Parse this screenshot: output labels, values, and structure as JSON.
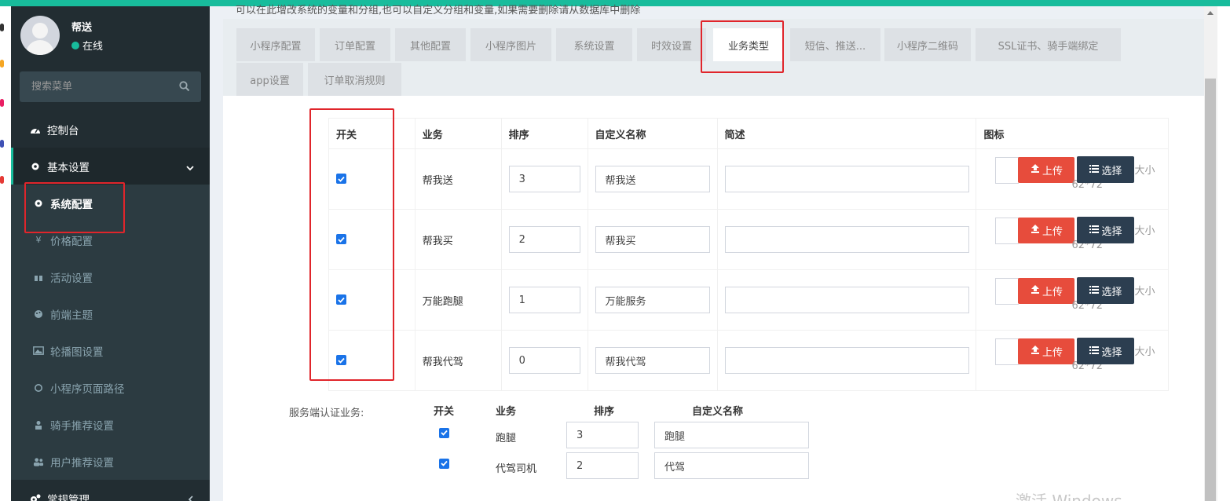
{
  "user": {
    "name": "帮送",
    "status": "在线"
  },
  "search": {
    "placeholder": "搜索菜单"
  },
  "menu": {
    "dashboard": "控制台",
    "basic_settings": "基本设置",
    "sub": [
      "系统配置",
      "价格配置",
      "活动设置",
      "前端主题",
      "轮播图设置",
      "小程序页面路径",
      "骑手推荐设置",
      "用户推荐设置"
    ],
    "general": "常规管理"
  },
  "tip": "可以在此增改系统的变量和分组,也可以自定义分组和变量,如果需要删除请从数据库中删除",
  "tabs": [
    "小程序配置",
    "订单配置",
    "其他配置",
    "小程序图片",
    "系统设置",
    "时效设置",
    "业务类型",
    "短信、推送...",
    "小程序二维码",
    "SSL证书、骑手端绑定",
    "app设置",
    "订单取消规则"
  ],
  "active_tab": "业务类型",
  "business_table": {
    "headers": [
      "开关",
      "业务",
      "排序",
      "自定义名称",
      "简述",
      "图标"
    ],
    "rows": [
      {
        "enabled": true,
        "business": "帮我送",
        "sort": "3",
        "custom_name": "帮我送",
        "desc": ""
      },
      {
        "enabled": true,
        "business": "帮我买",
        "sort": "2",
        "custom_name": "帮我买",
        "desc": ""
      },
      {
        "enabled": true,
        "business": "万能跑腿",
        "sort": "1",
        "custom_name": "万能服务",
        "desc": ""
      },
      {
        "enabled": true,
        "business": "帮我代驾",
        "sort": "0",
        "custom_name": "帮我代驾",
        "desc": ""
      }
    ],
    "upload_label": "上传",
    "select_label": "选择",
    "size_a": "大小",
    "size_b": "62*72"
  },
  "auth": {
    "label": "服务端认证业务:",
    "headers": [
      "开关",
      "业务",
      "排序",
      "自定义名称"
    ],
    "rows": [
      {
        "enabled": true,
        "business": "跑腿",
        "sort": "3",
        "custom_name": "跑腿"
      },
      {
        "enabled": true,
        "business": "代驾司机",
        "sort": "2",
        "custom_name": "代驾"
      }
    ]
  },
  "watermark": "激活 Windows",
  "colors": {
    "brand": "#18bc9c",
    "sidebar": "#222d32",
    "upload": "#e74c3c",
    "select": "#2c3e50",
    "highlight": "#e0252b",
    "checkbox": "#1a73e8"
  }
}
